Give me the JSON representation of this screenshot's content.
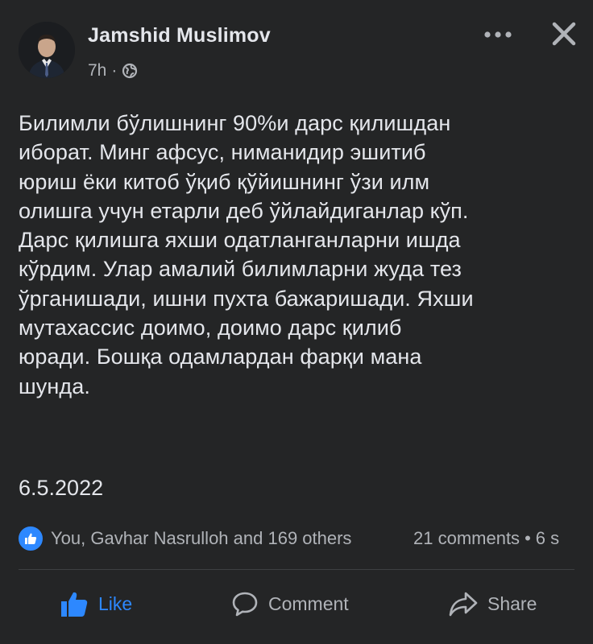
{
  "post": {
    "author": "Jamshid Muslimov",
    "time": "7h",
    "time_separator": "·",
    "privacy_icon": "globe-icon",
    "text_lines": [
      "Билимли бўлишнинг 90%и дарс қилишдан",
      "иборат. Минг афсус, ниманидир эшитиб",
      "юриш ёки китоб ўқиб қўйишнинг ўзи илм",
      "олишга учун етарли деб ўйлайдиганлар кўп.",
      "Дарс қилишга яхши одатланганларни ишда",
      "кўрдим. Улар амалий билимларни жуда тез",
      "ўрганишади, ишни пухта бажаришади. Яхши",
      "мутахассис доимо, доимо дарс қилиб",
      "юради. Бошқа одамлардан фарқи мана",
      "шунда."
    ],
    "date": "6.5.2022"
  },
  "reactions": {
    "summary": "You, Gavhar Nasrulloh and 169 others",
    "comments": "21 comments",
    "separator": "•",
    "shares": "6 s"
  },
  "actions": {
    "like_label": "Like",
    "comment_label": "Comment",
    "share_label": "Share"
  },
  "colors": {
    "background": "#242526",
    "text": "#e4e6eb",
    "secondary_text": "#b0b3b8",
    "accent": "#2d88ff",
    "divider": "#3e4042"
  }
}
